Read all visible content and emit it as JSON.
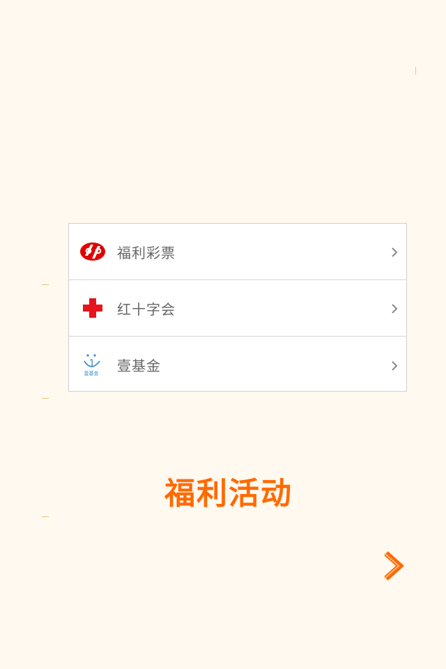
{
  "charities": [
    {
      "label": "福利彩票",
      "icon": "welfare-lottery-logo",
      "color": "#e00000"
    },
    {
      "label": "红十字会",
      "icon": "red-cross-logo",
      "color": "#e8141c"
    },
    {
      "label": "壹基金",
      "icon": "one-foundation-logo",
      "color": "#3a8fd0",
      "logo_text": "壹基金"
    }
  ],
  "event": {
    "title": "福利活动",
    "title_color": "#ff6a00"
  },
  "colors": {
    "background": "#fff9f0",
    "accent": "#ff6a00",
    "chevron": "#888888"
  }
}
